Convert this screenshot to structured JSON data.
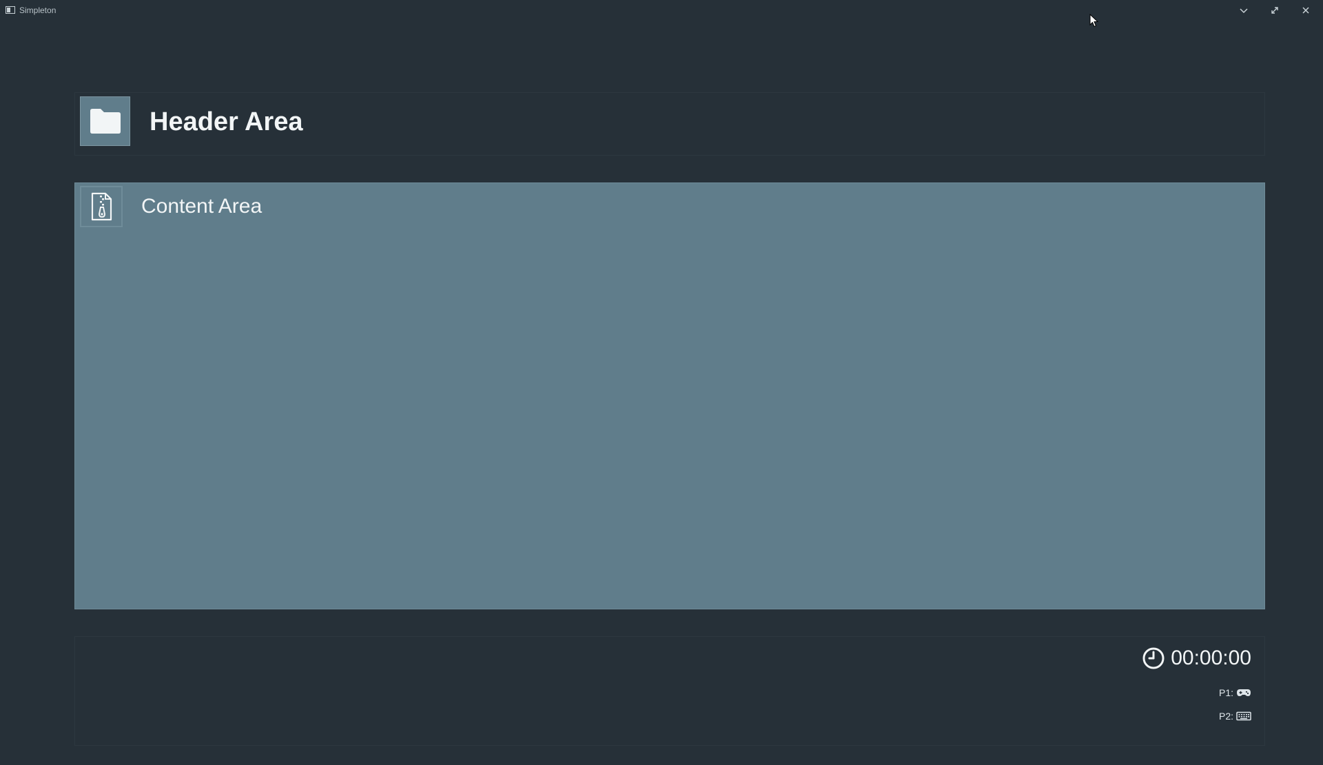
{
  "window": {
    "title": "Simpleton",
    "controls": {
      "minimize_icon": "chevron-down-icon",
      "maximize_icon": "expand-icon",
      "close_icon": "close-icon"
    }
  },
  "header": {
    "title": "Header Area",
    "icon": "folder-icon"
  },
  "content": {
    "title": "Content Area",
    "icon": "zip-file-icon"
  },
  "footer": {
    "timer": "00:00:00",
    "timer_icon": "clock-icon",
    "players": [
      {
        "label": "P1:",
        "device_icon": "gamepad-icon"
      },
      {
        "label": "P2:",
        "device_icon": "keyboard-icon"
      }
    ]
  },
  "colors": {
    "background": "#263038",
    "content_background": "#607d8b",
    "text": "#f2f5f6"
  }
}
